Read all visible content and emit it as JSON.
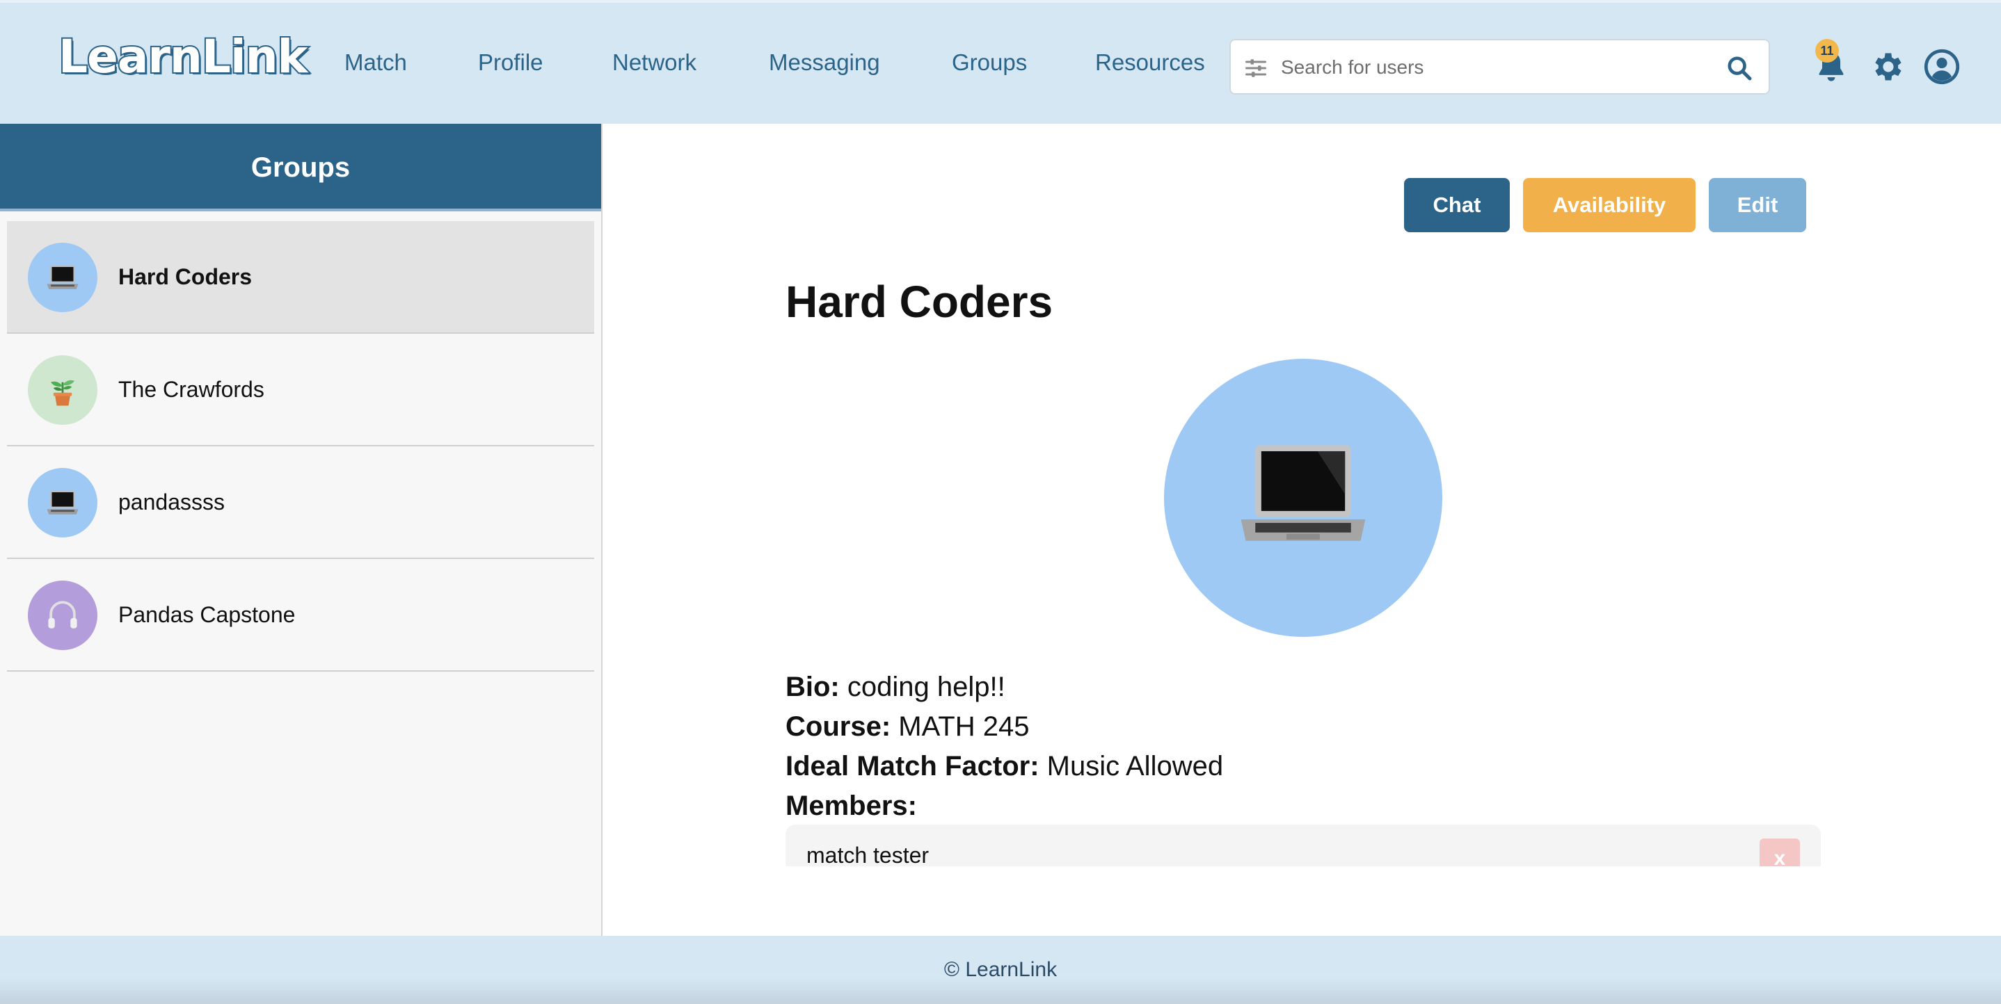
{
  "header": {
    "logo": "LearnLink",
    "nav": [
      {
        "label": "Match"
      },
      {
        "label": "Profile"
      },
      {
        "label": "Network"
      },
      {
        "label": "Messaging"
      },
      {
        "label": "Groups"
      },
      {
        "label": "Resources"
      }
    ],
    "search": {
      "placeholder": "Search for users",
      "value": ""
    },
    "notification_count": "11",
    "icons": [
      "filter-icon",
      "search-icon",
      "bell-icon",
      "gear-icon",
      "user-circle-icon"
    ]
  },
  "sidebar": {
    "title": "Groups",
    "groups": [
      {
        "name": "Hard Coders",
        "icon": "laptop-icon",
        "color": "#9ec9f4",
        "active": true
      },
      {
        "name": "The Crawfords",
        "icon": "potted-plant-icon",
        "color": "#cfe6cf",
        "active": false
      },
      {
        "name": "pandassss",
        "icon": "laptop-icon",
        "color": "#9ec9f4",
        "active": false
      },
      {
        "name": "Pandas Capstone",
        "icon": "headphones-icon",
        "color": "#b39ddb",
        "active": false
      }
    ]
  },
  "main": {
    "buttons": {
      "chat": "Chat",
      "availability": "Availability",
      "edit": "Edit"
    },
    "title": "Hard Coders",
    "avatar_icon": "laptop-icon",
    "bio_label": "Bio:",
    "bio": "coding help!!",
    "course_label": "Course:",
    "course": "MATH 245",
    "match_factor_label": "Ideal Match Factor:",
    "match_factor": "Music Allowed",
    "members_label": "Members:",
    "members": [
      {
        "name": "match tester",
        "remove_label": "x"
      }
    ]
  },
  "footer": {
    "text": "© LearnLink"
  },
  "colors": {
    "primary": "#2b6389",
    "accent": "#f2b04a",
    "light": "#7fb0d6",
    "header_bg": "#d6e7f4"
  }
}
